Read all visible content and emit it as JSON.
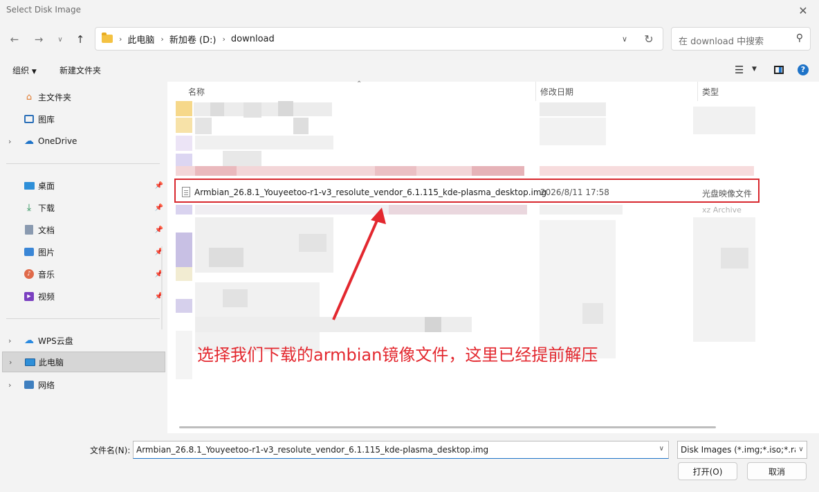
{
  "window": {
    "title": "Select Disk Image",
    "close_icon": "close-icon"
  },
  "navigation": {
    "back_icon": "arrow-left-icon",
    "forward_icon": "arrow-right-icon",
    "recent_icon": "chevron-down-icon",
    "up_icon": "arrow-up-icon",
    "breadcrumbs": [
      "此电脑",
      "新加卷 (D:)",
      "download"
    ],
    "search_placeholder": "在 download 中搜索"
  },
  "toolbar": {
    "organize": "组织",
    "new_folder": "新建文件夹"
  },
  "sidebar": {
    "items": [
      {
        "label": "主文件夹",
        "icon": "home-icon"
      },
      {
        "label": "图库",
        "icon": "gallery-icon"
      },
      {
        "label": "OneDrive",
        "icon": "cloud-icon"
      },
      {
        "label": "桌面",
        "icon": "desktop-icon"
      },
      {
        "label": "下载",
        "icon": "download-icon"
      },
      {
        "label": "文档",
        "icon": "document-icon"
      },
      {
        "label": "图片",
        "icon": "picture-icon"
      },
      {
        "label": "音乐",
        "icon": "music-icon"
      },
      {
        "label": "视频",
        "icon": "video-icon"
      },
      {
        "label": "WPS云盘",
        "icon": "wps-cloud-icon"
      },
      {
        "label": "此电脑",
        "icon": "computer-icon"
      },
      {
        "label": "网络",
        "icon": "network-icon"
      }
    ]
  },
  "columns": {
    "name": "名称",
    "date": "修改日期",
    "type": "类型"
  },
  "selected_file": {
    "name": "Armbian_26.8.1_Youyeetoo-r1-v3_resolute_vendor_6.1.115_kde-plasma_desktop.img",
    "date": "2026/8/11 17:58",
    "type": "光盘映像文件"
  },
  "partial_row": {
    "type": "xz Archive"
  },
  "annotation": "选择我们下载的armbian镜像文件，这里已经提前解压",
  "footer": {
    "filename_label": "文件名(N):",
    "filename_value": "Armbian_26.8.1_Youyeetoo-r1-v3_resolute_vendor_6.1.115_kde-plasma_desktop.img",
    "filter_value": "Disk Images (*.img;*.iso;*.raw;*.xz)",
    "open_button": "打开(O)",
    "cancel_button": "取消"
  },
  "colors": {
    "accent": "#1e73c8",
    "annotation": "#e3282f"
  }
}
